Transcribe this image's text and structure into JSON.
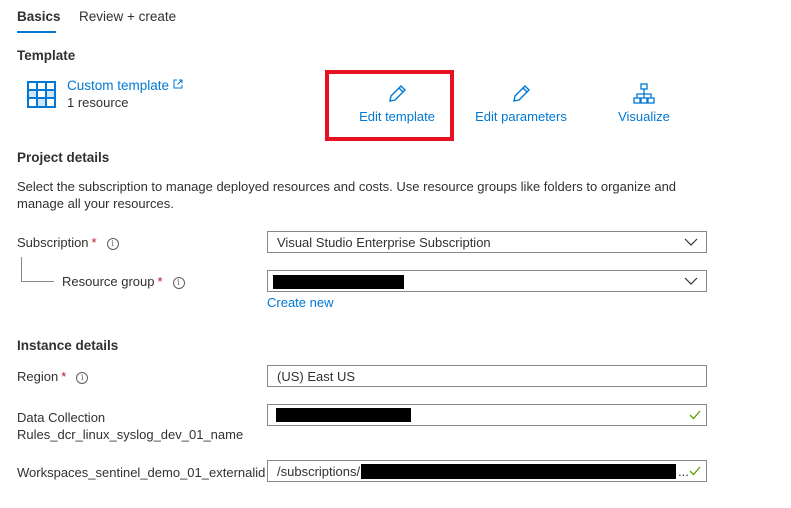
{
  "tabs": [
    {
      "label": "Basics",
      "active": true
    },
    {
      "label": "Review + create",
      "active": false
    }
  ],
  "template": {
    "heading": "Template",
    "name": "Custom template",
    "count": "1 resource",
    "actions": {
      "edit_template": "Edit template",
      "edit_parameters": "Edit parameters",
      "visualize": "Visualize"
    }
  },
  "project": {
    "heading": "Project details",
    "description": "Select the subscription to manage deployed resources and costs. Use resource groups like folders to organize and manage all your resources.",
    "subscription_label": "Subscription",
    "subscription_value": "Visual Studio Enterprise Subscription",
    "resource_group_label": "Resource group",
    "create_new": "Create new"
  },
  "instance": {
    "heading": "Instance details",
    "region_label": "Region",
    "region_value": "(US) East US",
    "dcr_label_line1": "Data Collection",
    "dcr_label_line2": "Rules_dcr_linux_syslog_dev_01_name",
    "workspaces_label": "Workspaces_sentinel_demo_01_externalid",
    "workspaces_value_prefix": "/subscriptions/",
    "workspaces_value_suffix": "..."
  },
  "required_marker": "*",
  "info_glyph": "i",
  "colors": {
    "accent": "#0078d4",
    "required": "#c50f1f",
    "valid": "#57a300",
    "highlight": "#e81123"
  }
}
